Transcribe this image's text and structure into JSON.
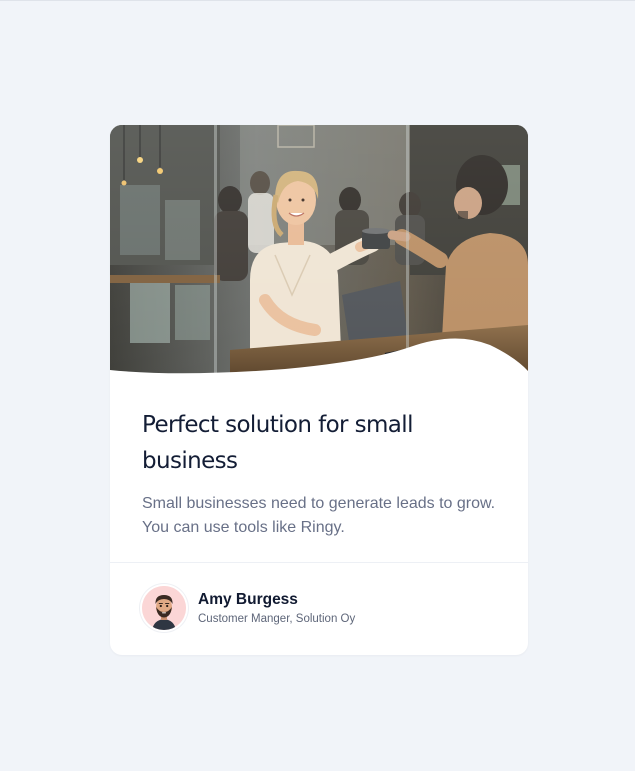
{
  "card": {
    "image": {
      "description_icon": "photo-office-handshake-icon"
    },
    "title": "Perfect solution for small business",
    "text": "Small businesses need to generate leads to grow. You can use tools like Ringy.",
    "author": {
      "name": "Amy Burgess",
      "role": "Customer Manger, Solution Oy",
      "avatar_icon": "bearded-man-avatar-icon"
    }
  },
  "colors": {
    "page_background": "#f1f4f9",
    "card_background": "#ffffff",
    "title": "#131d35",
    "body_text": "#687087",
    "avatar_background": "#fbd6d6"
  }
}
